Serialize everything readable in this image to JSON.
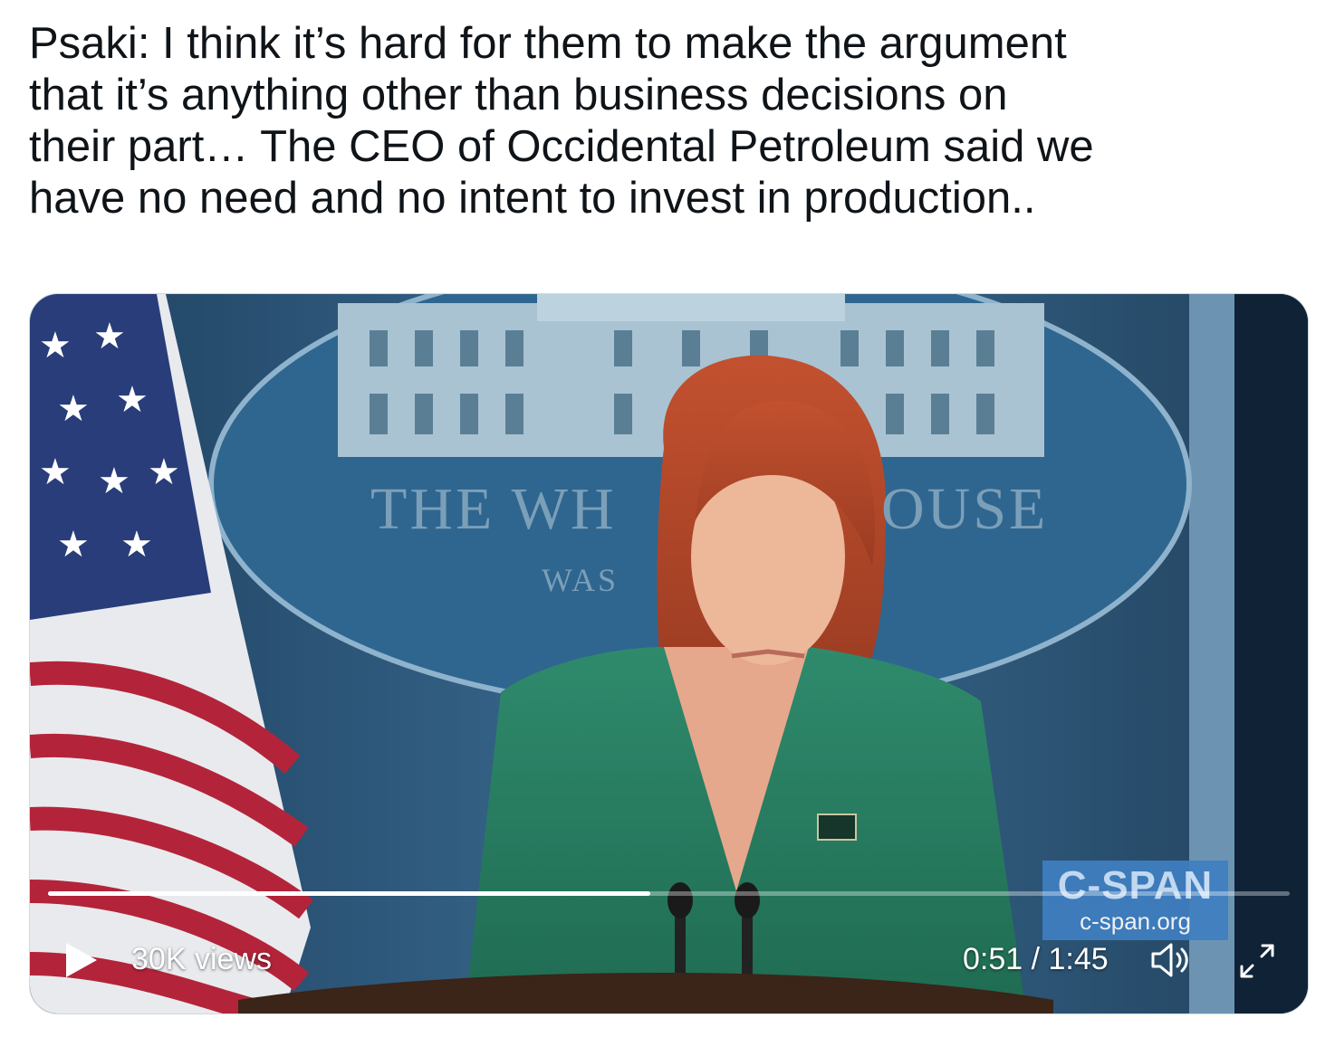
{
  "tweet": {
    "text": "Psaki: I think it’s hard for them to make the argument\nthat it’s anything other than business decisions on\ntheir part… The CEO of Occidental Petroleum said we\nhave no need and no intent to invest in production.."
  },
  "video": {
    "views": "30K views",
    "time": "0:51 / 1:45",
    "progress": 0.485,
    "seal_left": "THE WH",
    "seal_right": "OUSE",
    "seal_sub": "WAS",
    "watermark": {
      "name": "C-SPAN",
      "url": "c-span.org"
    },
    "icons": {
      "play": "play-icon",
      "volume": "volume-icon",
      "fullscreen": "fullscreen-icon"
    }
  }
}
